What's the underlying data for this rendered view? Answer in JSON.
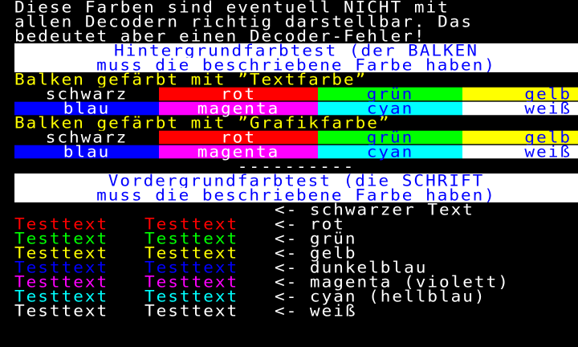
{
  "colors": {
    "black": "#000000",
    "white": "#ffffff",
    "red": "#ff0000",
    "green": "#00ff00",
    "yellow": "#ffff00",
    "blue": "#0000ff",
    "magenta": "#ff00ff",
    "cyan": "#00ffff"
  },
  "intro": [
    "Diese Farben sind eventuell NICHT mit",
    "allen Decodern richtig darstellbar. Das",
    "bedeutet aber einen Decoder-Fehler!"
  ],
  "bg_test": {
    "header": [
      "Hintergrundfarbtest (der BALKEN",
      "muss die beschriebene Farbe haben)"
    ],
    "text_color_label": "Balken gefärbt mit ”Textfarbe”",
    "graphic_color_label": "Balken gefärbt mit ”Grafikfarbe”",
    "row1": [
      "schwarz",
      "rot",
      "grün",
      "gelb"
    ],
    "row2": [
      "blau",
      "magenta",
      "cyan",
      "weiß"
    ]
  },
  "separator": "----------",
  "fg_test": {
    "header": [
      "Vordergrundfarbtest (die SCHRIFT",
      "muss die beschriebene Farbe haben)"
    ],
    "black_line": "<- schwarzer Text",
    "sample": "Testtext",
    "lines": [
      {
        "color": "#ff0000",
        "label": "<- rot"
      },
      {
        "color": "#00ff00",
        "label": "<- grün"
      },
      {
        "color": "#ffff00",
        "label": "<- gelb"
      },
      {
        "color": "#0000ff",
        "label": "<- dunkelblau"
      },
      {
        "color": "#ff00ff",
        "label": "<- magenta (violett)"
      },
      {
        "color": "#00ffff",
        "label": "<- cyan (hellblau)"
      },
      {
        "color": "#ffffff",
        "label": "<- weiß"
      }
    ]
  }
}
